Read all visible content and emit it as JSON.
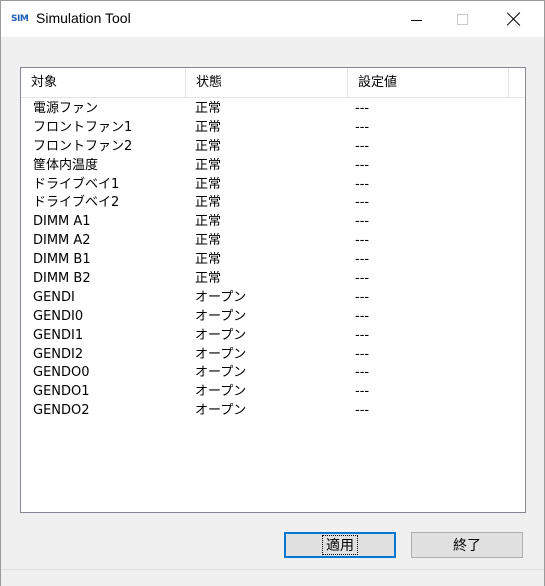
{
  "window": {
    "title": "Simulation Tool",
    "icon_label": "SIM",
    "icon": "app-icon"
  },
  "list": {
    "columns": [
      "対象",
      "状態",
      "設定値"
    ],
    "rows": [
      [
        "電源ファン",
        "正常",
        "---"
      ],
      [
        "フロントファン1",
        "正常",
        "---"
      ],
      [
        "フロントファン2",
        "正常",
        "---"
      ],
      [
        "筐体内温度",
        "正常",
        "---"
      ],
      [
        "ドライブベイ1",
        "正常",
        "---"
      ],
      [
        "ドライブベイ2",
        "正常",
        "---"
      ],
      [
        "DIMM A1",
        "正常",
        "---"
      ],
      [
        "DIMM A2",
        "正常",
        "---"
      ],
      [
        "DIMM B1",
        "正常",
        "---"
      ],
      [
        "DIMM B2",
        "正常",
        "---"
      ],
      [
        "GENDI",
        "オープン",
        "---"
      ],
      [
        "GENDI0",
        "オープン",
        "---"
      ],
      [
        "GENDI1",
        "オープン",
        "---"
      ],
      [
        "GENDI2",
        "オープン",
        "---"
      ],
      [
        "GENDO0",
        "オープン",
        "---"
      ],
      [
        "GENDO1",
        "オープン",
        "---"
      ],
      [
        "GENDO2",
        "オープン",
        "---"
      ]
    ]
  },
  "buttons": {
    "apply": "適用",
    "exit": "終了"
  },
  "colors": {
    "accent": "#0078d7",
    "icon": "#1a5fb4"
  }
}
